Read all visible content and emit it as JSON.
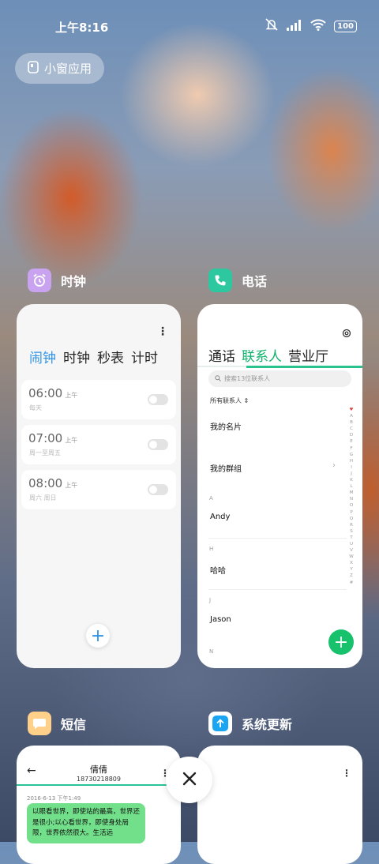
{
  "status": {
    "time": "上午8:16",
    "battery": "100"
  },
  "small_window": {
    "label": "小窗应用"
  },
  "apps": {
    "clock": {
      "name": "时钟",
      "tabs": [
        "闹钟",
        "时钟",
        "秒表",
        "计时"
      ],
      "alarms": [
        {
          "time": "06:00",
          "ampm": "上午",
          "repeat": "每天"
        },
        {
          "time": "07:00",
          "ampm": "上午",
          "repeat": "周一至周五"
        },
        {
          "time": "08:00",
          "ampm": "上午",
          "repeat": "周六 周日"
        }
      ],
      "add": "+"
    },
    "phone": {
      "name": "电话",
      "tabs": [
        "通话",
        "联系人",
        "营业厅"
      ],
      "search_placeholder": "搜索13位联系人",
      "all_contacts": "所有联系人",
      "my_card": "我的名片",
      "my_groups": "我的群组",
      "sections": [
        "A",
        "H",
        "J",
        "N"
      ],
      "contacts": [
        "Andy",
        "哈哈",
        "Jason"
      ],
      "index": [
        "♥",
        "A",
        "B",
        "C",
        "D",
        "E",
        "F",
        "G",
        "H",
        "I",
        "J",
        "K",
        "L",
        "M",
        "N",
        "O",
        "P",
        "Q",
        "R",
        "S",
        "T",
        "U",
        "V",
        "W",
        "X",
        "Y",
        "Z",
        "#"
      ],
      "fab": "+"
    },
    "sms": {
      "name": "短信",
      "contact": "倩倩",
      "number": "18730218809",
      "timestamp": "2016-6-13 下午1:49",
      "message": "以眼看世界，即使站的最高，世界还是很小;以心看世界，即使身处局限，世界依然很大。生活远"
    },
    "update": {
      "name": "系统更新"
    }
  }
}
